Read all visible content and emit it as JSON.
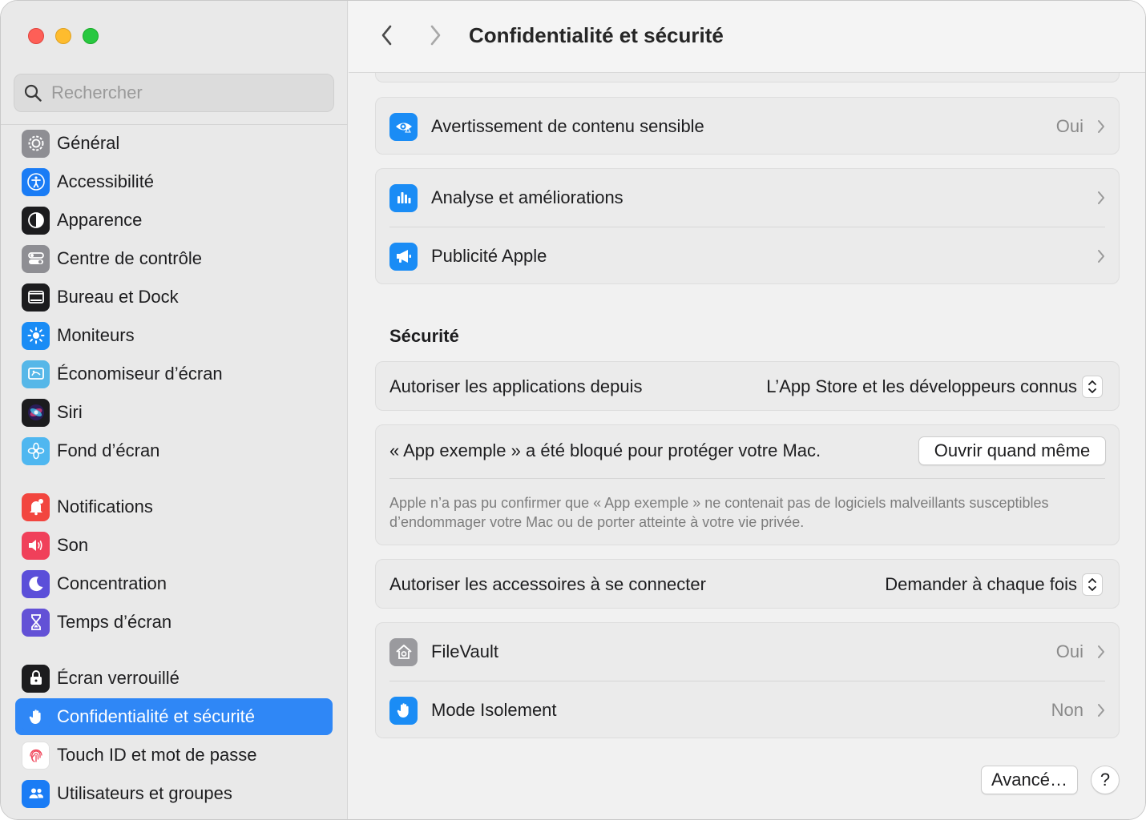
{
  "sidebar": {
    "search_placeholder": "Rechercher",
    "items": [
      {
        "label": "Général",
        "icon": "gear-icon",
        "color": "#8e8e93"
      },
      {
        "label": "Accessibilité",
        "icon": "accessibility-icon",
        "color": "#1a7cf5"
      },
      {
        "label": "Apparence",
        "icon": "appearance-icon",
        "color": "#1c1c1e"
      },
      {
        "label": "Centre de contrôle",
        "icon": "control-center-icon",
        "color": "#8e8e93"
      },
      {
        "label": "Bureau et Dock",
        "icon": "desktop-dock-icon",
        "color": "#1c1c1e"
      },
      {
        "label": "Moniteurs",
        "icon": "displays-icon",
        "color": "#1a8cf5"
      },
      {
        "label": "Économiseur d’écran",
        "icon": "screensaver-icon",
        "color": "#56b7e8"
      },
      {
        "label": "Siri",
        "icon": "siri-icon",
        "color": "#1c1c1e"
      },
      {
        "label": "Fond d’écran",
        "icon": "wallpaper-icon",
        "color": "#4fb7f0"
      },
      {
        "label": "Notifications",
        "icon": "bell-icon",
        "color": "#f2463f"
      },
      {
        "label": "Son",
        "icon": "speaker-icon",
        "color": "#f0405a"
      },
      {
        "label": "Concentration",
        "icon": "moon-icon",
        "color": "#5b4fd9"
      },
      {
        "label": "Temps d’écran",
        "icon": "hourglass-icon",
        "color": "#6351d6"
      },
      {
        "label": "Écran verrouillé",
        "icon": "lock-icon",
        "color": "#1c1c1e"
      },
      {
        "label": "Confidentialité et sécurité",
        "icon": "hand-icon",
        "color": "#2f87f6",
        "selected": true
      },
      {
        "label": "Touch ID et mot de passe",
        "icon": "fingerprint-icon",
        "color": "#ffffff"
      },
      {
        "label": "Utilisateurs et groupes",
        "icon": "users-icon",
        "color": "#1a7cf5"
      }
    ]
  },
  "header": {
    "title": "Confidentialité et sécurité"
  },
  "privacy": {
    "sensitive": {
      "label": "Avertissement de contenu sensible",
      "value": "Oui"
    },
    "analytics": {
      "label": "Analyse et améliorations"
    },
    "ads": {
      "label": "Publicité Apple"
    }
  },
  "security": {
    "title": "Sécurité",
    "allow_apps": {
      "label": "Autoriser les applications depuis",
      "value": "L’App Store et les développeurs connus"
    },
    "blocked": {
      "message": "« App exemple » a été bloqué pour protéger votre Mac.",
      "button": "Ouvrir quand même",
      "description": "Apple n’a pas pu confirmer que « App exemple » ne contenait pas de logiciels malveillants susceptibles d’endommager votre Mac ou de porter atteinte à votre vie privée."
    },
    "accessories": {
      "label": "Autoriser les accessoires à se connecter",
      "value": "Demander à chaque fois"
    },
    "filevault": {
      "label": "FileVault",
      "value": "Oui"
    },
    "lockdown": {
      "label": "Mode Isolement",
      "value": "Non"
    }
  },
  "footer": {
    "advanced_button": "Avancé…",
    "help_button": "?"
  },
  "colors": {
    "accent": "#2f87f6",
    "sidebar_bg": "#e9e9e9",
    "content_bg": "#f1f1f1"
  }
}
